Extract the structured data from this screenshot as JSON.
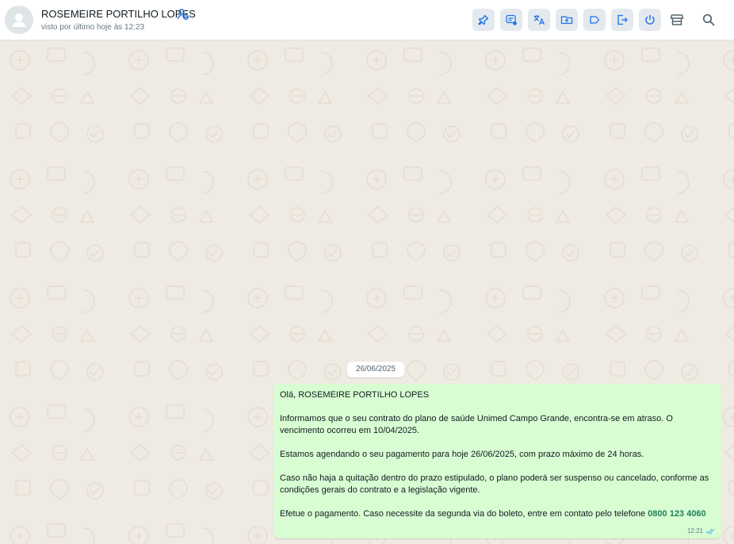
{
  "contact": {
    "name": "ROSEMEIRE PORTILHO LOPES",
    "last_seen": "visto por último hoje às 12:23",
    "verified_icon": "contacts-badge-icon",
    "avatar_icon": "default-avatar-icon"
  },
  "toolbar": {
    "buttons": [
      {
        "icon": "pin-icon"
      },
      {
        "icon": "message-settings-icon"
      },
      {
        "icon": "translate-icon"
      },
      {
        "icon": "folder-upload-icon"
      },
      {
        "icon": "label-icon"
      },
      {
        "icon": "logout-icon"
      },
      {
        "icon": "power-icon"
      }
    ],
    "store_icon": "store-icon",
    "search_icon": "search-icon"
  },
  "chat": {
    "date_chip": "26/06/2025",
    "message": {
      "greeting": "Olá, ROSEMEIRE PORTILHO LOPES",
      "p1": "Informamos que o seu contrato do plano de saúde Unimed Campo Grande, encontra-se em atraso. O vencimento ocorreu em 10/04/2025.",
      "p2": "Estamos agendando o seu pagamento para hoje 26/06/2025, com prazo máximo de 24 horas.",
      "p3": "Caso não haja a quitação dentro do prazo estipulado, o plano poderá ser suspenso ou cancelado, conforme as condições gerais do contrato e a legislação vigente.",
      "p4": "Efetue o pagamento. Caso necessite da segunda via do boleto, entre em contato pelo telefone",
      "phone": "0800 123 4060",
      "time": "12:21",
      "status_icon": "double-check-icon"
    }
  },
  "colors": {
    "bubble": "#d9fdd3",
    "background": "#efeae2",
    "accent": "#1e7f5a",
    "icon_blue": "#1a73e8"
  }
}
